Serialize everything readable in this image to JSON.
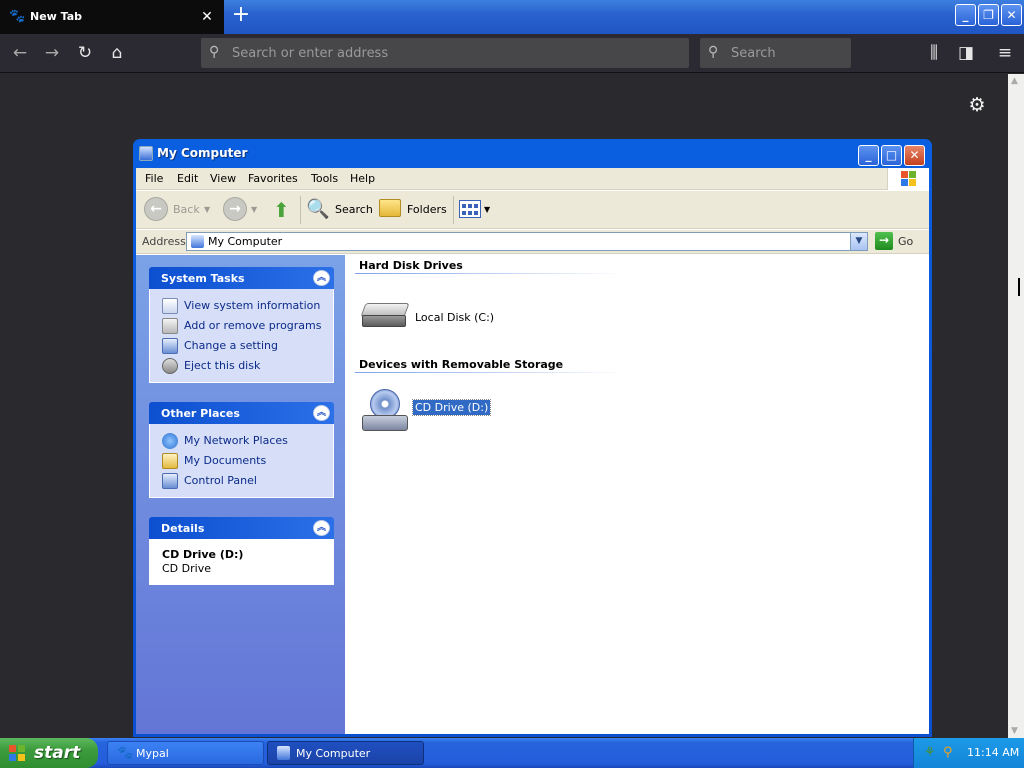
{
  "browser": {
    "tab_title": "New Tab",
    "tab_close": "✕",
    "new_tab": "+",
    "url_placeholder": "Search or enter address",
    "search_placeholder": "Search"
  },
  "window": {
    "title": "My Computer",
    "menu": [
      "File",
      "Edit",
      "View",
      "Favorites",
      "Tools",
      "Help"
    ],
    "toolbar": {
      "back": "Back",
      "search": "Search",
      "folders": "Folders"
    },
    "address": {
      "label": "Address",
      "value": "My Computer",
      "go": "Go"
    },
    "system_tasks": {
      "title": "System Tasks",
      "items": [
        "View system information",
        "Add or remove programs",
        "Change a setting",
        "Eject this disk"
      ]
    },
    "other_places": {
      "title": "Other Places",
      "items": [
        "My Network Places",
        "My Documents",
        "Control Panel"
      ]
    },
    "details": {
      "title": "Details",
      "name": "CD Drive (D:)",
      "type": "CD Drive"
    },
    "groups": {
      "hard_disks": "Hard Disk Drives",
      "removable": "Devices with Removable Storage"
    },
    "drives": {
      "local": "Local Disk (C:)",
      "cd": "CD Drive (D:)"
    }
  },
  "taskbar": {
    "start": "start",
    "buttons": [
      "Mypal",
      "My Computer"
    ],
    "clock": "11:14 AM"
  },
  "colors": {
    "xp_blue": "#0b4fd1",
    "taskbar_blue": "#245ddb",
    "start_green": "#3c9b3c",
    "selection": "#316ac5"
  }
}
